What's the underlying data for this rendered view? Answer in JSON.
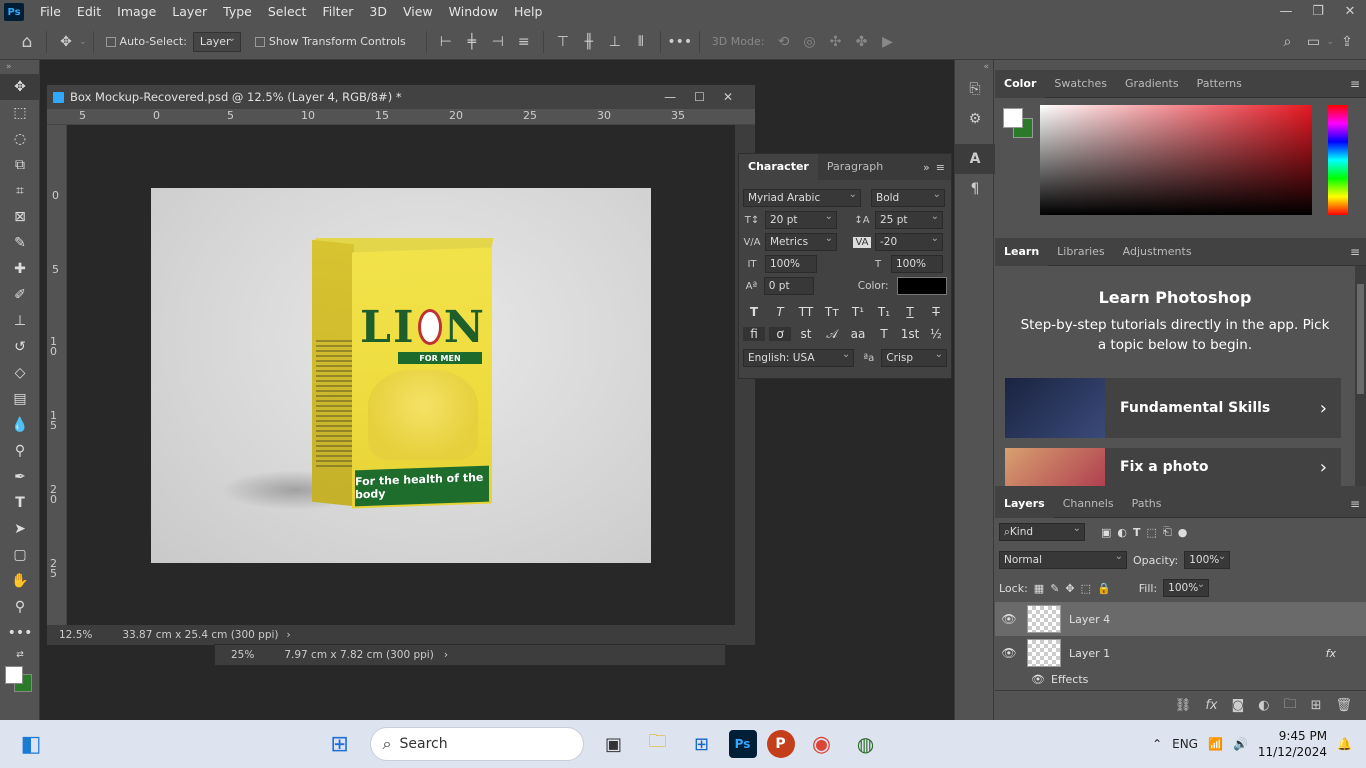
{
  "menubar": {
    "logo": "Ps",
    "items": [
      "File",
      "Edit",
      "Image",
      "Layer",
      "Type",
      "Select",
      "Filter",
      "3D",
      "View",
      "Window",
      "Help"
    ]
  },
  "options": {
    "auto_select_label": "Auto-Select:",
    "auto_select_value": "Layer",
    "show_transform_label": "Show Transform Controls",
    "mode_3d_label": "3D Mode:"
  },
  "document": {
    "title": "Box Mockup-Recovered.psd @ 12.5% (Layer 4, RGB/8#) *",
    "zoom": "12.5%",
    "size": "33.87 cm x 25.4 cm (300 ppi)",
    "ruler_top": [
      "5",
      "0",
      "5",
      "10",
      "15",
      "20",
      "25",
      "30",
      "35"
    ],
    "ruler_left": [
      "0",
      "5",
      "10",
      "15",
      "20",
      "25"
    ],
    "box_band_text": "For the health of the body",
    "box_logo_l": "LI",
    "box_logo_n": "N",
    "box_formen": "FOR MEN"
  },
  "document2": {
    "zoom": "25%",
    "size": "7.97 cm x 7.82 cm (300 ppi)"
  },
  "character": {
    "tabs": [
      "Character",
      "Paragraph"
    ],
    "font_family": "Myriad Arabic",
    "font_style": "Bold",
    "font_size": "20 pt",
    "leading": "25 pt",
    "kerning": "Metrics",
    "tracking": "-20",
    "vscale": "100%",
    "hscale": "100%",
    "baseline": "0 pt",
    "color_label": "Color:",
    "language": "English: USA",
    "antialias": "Crisp",
    "aa_label": "ªa"
  },
  "color_panel": {
    "tabs": [
      "Color",
      "Swatches",
      "Gradients",
      "Patterns"
    ]
  },
  "learn_panel": {
    "tabs": [
      "Learn",
      "Libraries",
      "Adjustments"
    ],
    "title": "Learn Photoshop",
    "subtitle": "Step-by-step tutorials directly in the app. Pick a topic below to begin.",
    "cards": [
      "Fundamental Skills",
      "Fix a photo"
    ]
  },
  "layers_panel": {
    "tabs": [
      "Layers",
      "Channels",
      "Paths"
    ],
    "kind_label": "Kind",
    "blend_mode": "Normal",
    "opacity_label": "Opacity:",
    "opacity": "100%",
    "lock_label": "Lock:",
    "fill_label": "Fill:",
    "fill": "100%",
    "layers": [
      {
        "name": "Layer 4"
      },
      {
        "name": "Layer 1"
      }
    ],
    "effects_label": "Effects",
    "fx": "fx"
  },
  "taskbar": {
    "search": "Search",
    "lang": "ENG",
    "time": "9:45 PM",
    "date": "11/12/2024"
  },
  "colors": {
    "fg": "#ffffff",
    "bg": "#2a7a2a",
    "text_color": "#000000"
  }
}
